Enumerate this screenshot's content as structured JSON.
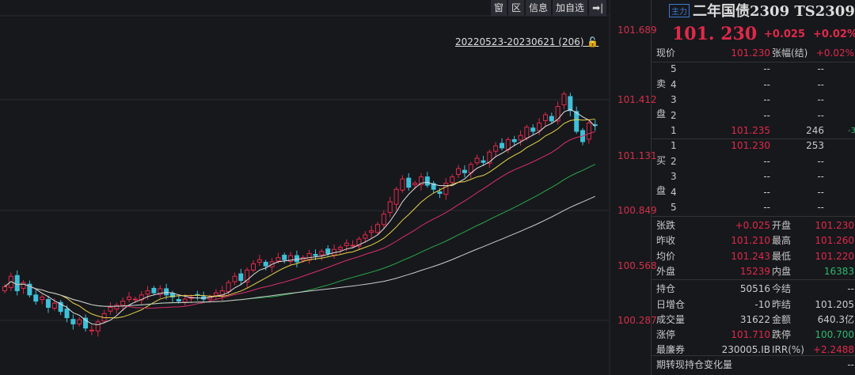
{
  "toolbar": [
    "窗",
    "区",
    "信息",
    "加自选",
    "➡|"
  ],
  "range_label": "20220523-20230621 (206)",
  "y_axis": [
    "101.689",
    "101.412",
    "101.131",
    "100.849",
    "100.568",
    "100.287"
  ],
  "title": {
    "badge": "主力",
    "name": "二年国债2309 TS2309"
  },
  "price": "101. 230",
  "change": "+0.025",
  "change_pct": "+0.02%",
  "now": {
    "label": "现价",
    "value": "101.230",
    "label2": "张幅(结)",
    "value2": "+0.02%"
  },
  "sell_label": [
    "卖",
    "盘"
  ],
  "buy_label": [
    "买",
    "盘"
  ],
  "asks": [
    {
      "lvl": "5",
      "p": "--",
      "v": "--"
    },
    {
      "lvl": "4",
      "p": "--",
      "v": "--"
    },
    {
      "lvl": "3",
      "p": "--",
      "v": "--"
    },
    {
      "lvl": "2",
      "p": "--",
      "v": "--"
    },
    {
      "lvl": "1",
      "p": "101.235",
      "v": "246",
      "d": "-3"
    }
  ],
  "bids": [
    {
      "lvl": "1",
      "p": "101.230",
      "v": "253"
    },
    {
      "lvl": "2",
      "p": "--",
      "v": "--"
    },
    {
      "lvl": "3",
      "p": "--",
      "v": "--"
    },
    {
      "lvl": "4",
      "p": "--",
      "v": "--"
    },
    {
      "lvl": "5",
      "p": "--",
      "v": "--"
    }
  ],
  "stats": [
    [
      "张跌",
      "+0.025",
      "开盘",
      "101.230",
      "red",
      "red"
    ],
    [
      "昨收",
      "101.210",
      "最高",
      "101.260",
      "red",
      "red"
    ],
    [
      "均价",
      "101.243",
      "最低",
      "101.220",
      "red",
      "red"
    ],
    [
      "外盘",
      "15239",
      "内盘",
      "16383",
      "red",
      "green"
    ],
    [
      "持仓",
      "50516",
      "今结",
      "--",
      "w",
      "w"
    ],
    [
      "日增仓",
      "-10",
      "昨结",
      "101.205",
      "w",
      "w"
    ],
    [
      "成交量",
      "31622",
      "金额",
      "640.3亿",
      "w",
      "w"
    ],
    [
      "涨停",
      "101.710",
      "跌停",
      "100.700",
      "red",
      "green"
    ],
    [
      "最廉券",
      "230005.IB",
      "IRR(%)",
      "+2.2488",
      "w",
      "red"
    ]
  ],
  "footer": {
    "label": "期转现持仓变化量",
    "value": "--"
  },
  "colors": {
    "up": "#e0294a",
    "down": "#3ec0d8",
    "ma5": "#e0e0e0",
    "ma10": "#e8d24a",
    "ma20": "#d9306a",
    "ma40": "#2aa84a",
    "ma60": "#cccccc"
  },
  "chart_data": {
    "type": "candlestick",
    "ylim": [
      100.18,
      101.75
    ],
    "closes": [
      100.45,
      100.5,
      100.43,
      100.47,
      100.41,
      100.38,
      100.4,
      100.35,
      100.37,
      100.33,
      100.3,
      100.27,
      100.29,
      100.25,
      100.24,
      100.28,
      100.32,
      100.35,
      100.36,
      100.38,
      100.4,
      100.39,
      100.41,
      100.43,
      100.42,
      100.44,
      100.41,
      100.4,
      100.38,
      100.39,
      100.4,
      100.41,
      100.39,
      100.4,
      100.42,
      100.43,
      100.47,
      100.5,
      100.48,
      100.53,
      100.56,
      100.58,
      100.55,
      100.57,
      100.59,
      100.58,
      100.6,
      100.57,
      100.59,
      100.61,
      100.6,
      100.62,
      100.61,
      100.63,
      100.64,
      100.66,
      100.65,
      100.68,
      100.7,
      100.72,
      100.75,
      100.8,
      100.86,
      100.92,
      100.97,
      100.93,
      100.95,
      100.98,
      100.94,
      100.92,
      100.9,
      100.95,
      100.98,
      101.02,
      101.0,
      101.04,
      101.07,
      101.05,
      101.1,
      101.13,
      101.12,
      101.16,
      101.15,
      101.18,
      101.22,
      101.2,
      101.24,
      101.28,
      101.25,
      101.32,
      101.38,
      101.3,
      101.2,
      101.15,
      101.24,
      101.23
    ]
  }
}
